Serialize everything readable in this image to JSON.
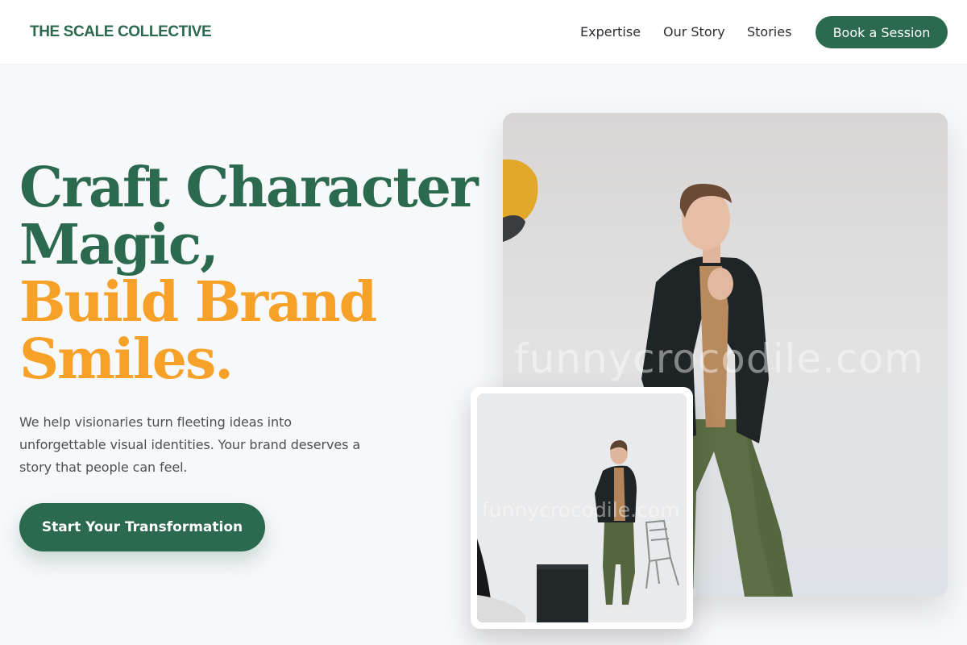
{
  "header": {
    "logo": "THE SCALE COLLECTIVE",
    "nav": [
      {
        "label": "Expertise"
      },
      {
        "label": "Our Story"
      },
      {
        "label": "Stories"
      }
    ],
    "cta_label": "Book a Session"
  },
  "hero": {
    "headline_line1": "Craft Character",
    "headline_line2": "Magic,",
    "headline_line3": "Build Brand",
    "headline_line4": "Smiles.",
    "description": "We help visionaries turn fleeting ideas into unforgettable visual identities. Your brand deserves a story that people can feel.",
    "cta_label": "Start Your Transformation"
  },
  "images": {
    "main_watermark": "funnycrocodile.com",
    "inset_watermark": "funnycrocodile.com"
  },
  "colors": {
    "brand_green": "#2b6a4f",
    "accent_orange": "#f7a128",
    "background": "#f7f8fa"
  }
}
